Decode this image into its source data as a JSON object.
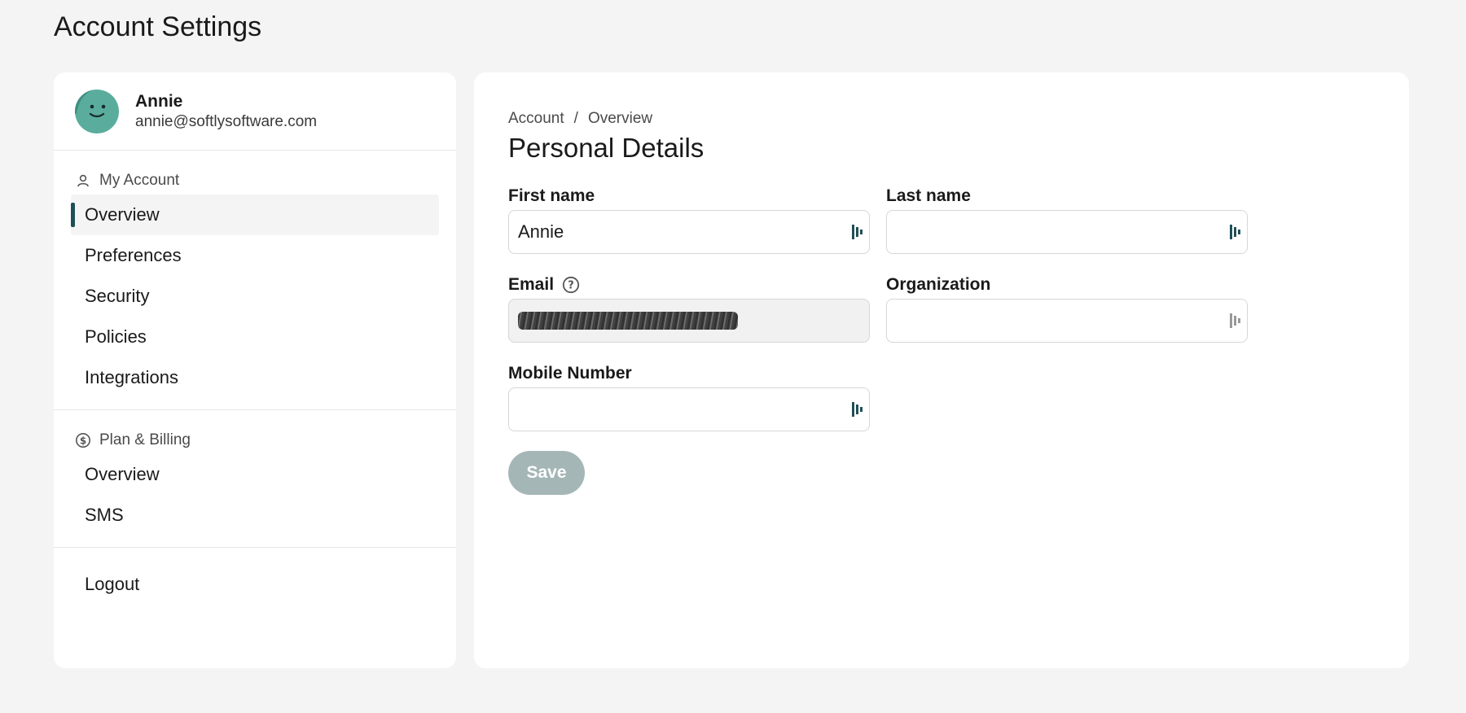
{
  "page": {
    "title": "Account Settings"
  },
  "profile": {
    "name": "Annie",
    "email": "annie@softlysoftware.com"
  },
  "sidebar": {
    "sections": [
      {
        "heading": "My Account",
        "icon": "person-icon",
        "items": [
          "Overview",
          "Preferences",
          "Security",
          "Policies",
          "Integrations"
        ],
        "active": 0
      },
      {
        "heading": "Plan & Billing",
        "icon": "dollar-circle-icon",
        "items": [
          "Overview",
          "SMS"
        ]
      },
      {
        "heading": "",
        "items": [
          "Logout"
        ]
      }
    ]
  },
  "main": {
    "breadcrumb": {
      "root": "Account",
      "separator": "/",
      "current": "Overview"
    },
    "title": "Personal Details",
    "fields": {
      "first_name": {
        "label": "First name",
        "value": "Annie",
        "placeholder": ""
      },
      "last_name": {
        "label": "Last name",
        "value": "",
        "placeholder": ""
      },
      "email": {
        "label": "Email",
        "value": "",
        "placeholder": ""
      },
      "organization": {
        "label": "Organization",
        "value": "",
        "placeholder": ""
      },
      "mobile": {
        "label": "Mobile Number",
        "value": "",
        "placeholder": ""
      }
    },
    "save_label": "Save"
  },
  "colors": {
    "accent": "#1f4f57",
    "avatar": "#5aad9c",
    "save_disabled": "#a5b6b7",
    "background": "#f4f4f4"
  }
}
